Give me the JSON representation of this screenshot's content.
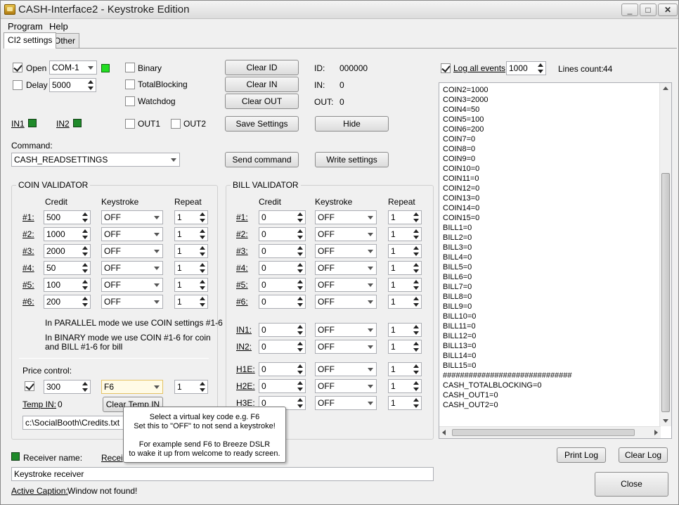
{
  "window": {
    "title": "CASH-Interface2 - Keystroke Edition",
    "minimize": "_",
    "maximize": "□",
    "close": "✕"
  },
  "menu": [
    "Program",
    "Help"
  ],
  "tabs": [
    "CI2 settings",
    "Other"
  ],
  "connection": {
    "open_label": "Open",
    "open_checked": true,
    "port": "COM-1",
    "delay_label": "Delay",
    "delay_checked": false,
    "delay_value": "5000",
    "binary_label": "Binary",
    "totalblocking_label": "TotalBlocking",
    "watchdog_label": "Watchdog",
    "in1_label": "IN1",
    "in2_label": "IN2",
    "out1_label": "OUT1",
    "out2_label": "OUT2"
  },
  "buttons": {
    "clear_id": "Clear ID",
    "clear_in": "Clear IN",
    "clear_out": "Clear OUT",
    "save_settings": "Save Settings",
    "hide": "Hide",
    "send_command": "Send command",
    "write_settings": "Write settings",
    "clear_temp_in": "Clear Temp IN",
    "print_log": "Print Log",
    "clear_log": "Clear Log",
    "close": "Close"
  },
  "status": {
    "id_label": "ID:",
    "id_value": "000000",
    "in_label": "IN:",
    "in_value": "0",
    "out_label": "OUT:",
    "out_value": "0"
  },
  "command": {
    "label": "Command:",
    "value": "CASH_READSETTINGS"
  },
  "coin_validator": {
    "title": "COIN VALIDATOR",
    "headers": [
      "Credit",
      "Keystroke",
      "Repeat"
    ],
    "rows": [
      {
        "label": "#1:",
        "credit": "500",
        "keystroke": "OFF",
        "repeat": "1"
      },
      {
        "label": "#2:",
        "credit": "1000",
        "keystroke": "OFF",
        "repeat": "1"
      },
      {
        "label": "#3:",
        "credit": "2000",
        "keystroke": "OFF",
        "repeat": "1"
      },
      {
        "label": "#4:",
        "credit": "50",
        "keystroke": "OFF",
        "repeat": "1"
      },
      {
        "label": "#5:",
        "credit": "100",
        "keystroke": "OFF",
        "repeat": "1"
      },
      {
        "label": "#6:",
        "credit": "200",
        "keystroke": "OFF",
        "repeat": "1"
      }
    ],
    "note1": "In PARALLEL mode we use COIN settings #1-6",
    "note2a": "In BINARY mode we use COIN #1-6 for coin",
    "note2b": "and BILL #1-6 for bill",
    "price_control_label": "Price control:",
    "price": {
      "checked": true,
      "credit": "300",
      "keystroke": "F6",
      "repeat": "1"
    },
    "temp_in_label": "Temp IN:",
    "temp_in_value": "0",
    "file_path": "c:\\SocialBooth\\Credits.txt"
  },
  "bill_validator": {
    "title": "BILL VALIDATOR",
    "headers": [
      "Credit",
      "Keystroke",
      "Repeat"
    ],
    "rows": [
      {
        "label": "#1:",
        "credit": "0",
        "keystroke": "OFF",
        "repeat": "1"
      },
      {
        "label": "#2:",
        "credit": "0",
        "keystroke": "OFF",
        "repeat": "1"
      },
      {
        "label": "#3:",
        "credit": "0",
        "keystroke": "OFF",
        "repeat": "1"
      },
      {
        "label": "#4:",
        "credit": "0",
        "keystroke": "OFF",
        "repeat": "1"
      },
      {
        "label": "#5:",
        "credit": "0",
        "keystroke": "OFF",
        "repeat": "1"
      },
      {
        "label": "#6:",
        "credit": "0",
        "keystroke": "OFF",
        "repeat": "1"
      }
    ],
    "extra_rows_a": [
      {
        "label": "IN1:",
        "credit": "0",
        "keystroke": "OFF",
        "repeat": "1"
      },
      {
        "label": "IN2:",
        "credit": "0",
        "keystroke": "OFF",
        "repeat": "1"
      }
    ],
    "extra_rows_b": [
      {
        "label": "H1E:",
        "credit": "0",
        "keystroke": "OFF",
        "repeat": "1"
      },
      {
        "label": "H2E:",
        "credit": "0",
        "keystroke": "OFF",
        "repeat": "1"
      },
      {
        "label": "H3E:",
        "credit": "0",
        "keystroke": "OFF",
        "repeat": "1"
      }
    ]
  },
  "log": {
    "log_all_label": "Log all events",
    "log_all_checked": true,
    "max_lines": "1000",
    "lines_count_label": "Lines count:",
    "lines_count_value": "44",
    "lines": [
      "COIN2=1000",
      "COIN3=2000",
      "COIN4=50",
      "COIN5=100",
      "COIN6=200",
      "COIN7=0",
      "COIN8=0",
      "COIN9=0",
      "COIN10=0",
      "COIN11=0",
      "COIN12=0",
      "COIN13=0",
      "COIN14=0",
      "COIN15=0",
      "BILL1=0",
      "BILL2=0",
      "BILL3=0",
      "BILL4=0",
      "BILL5=0",
      "BILL6=0",
      "BILL7=0",
      "BILL8=0",
      "BILL9=0",
      "BILL10=0",
      "BILL11=0",
      "BILL12=0",
      "BILL13=0",
      "BILL14=0",
      "BILL15=0",
      "##############################",
      "CASH_TOTALBLOCKING=0",
      "CASH_OUT1=0",
      "CASH_OUT2=0"
    ]
  },
  "receiver": {
    "name_label": "Receiver name:",
    "name_label2": "Recei",
    "name_value": "Keystroke receiver",
    "active_caption_label": "Active Caption:",
    "active_caption_value": "Window not found!"
  },
  "tooltip": {
    "line1": "Select a virtual key code e.g. F6",
    "line2": "Set this to \"OFF\" to not send a keystroke!",
    "line3": "For example send F6 to Breeze DSLR",
    "line4": "to wake it up from welcome to ready screen."
  }
}
